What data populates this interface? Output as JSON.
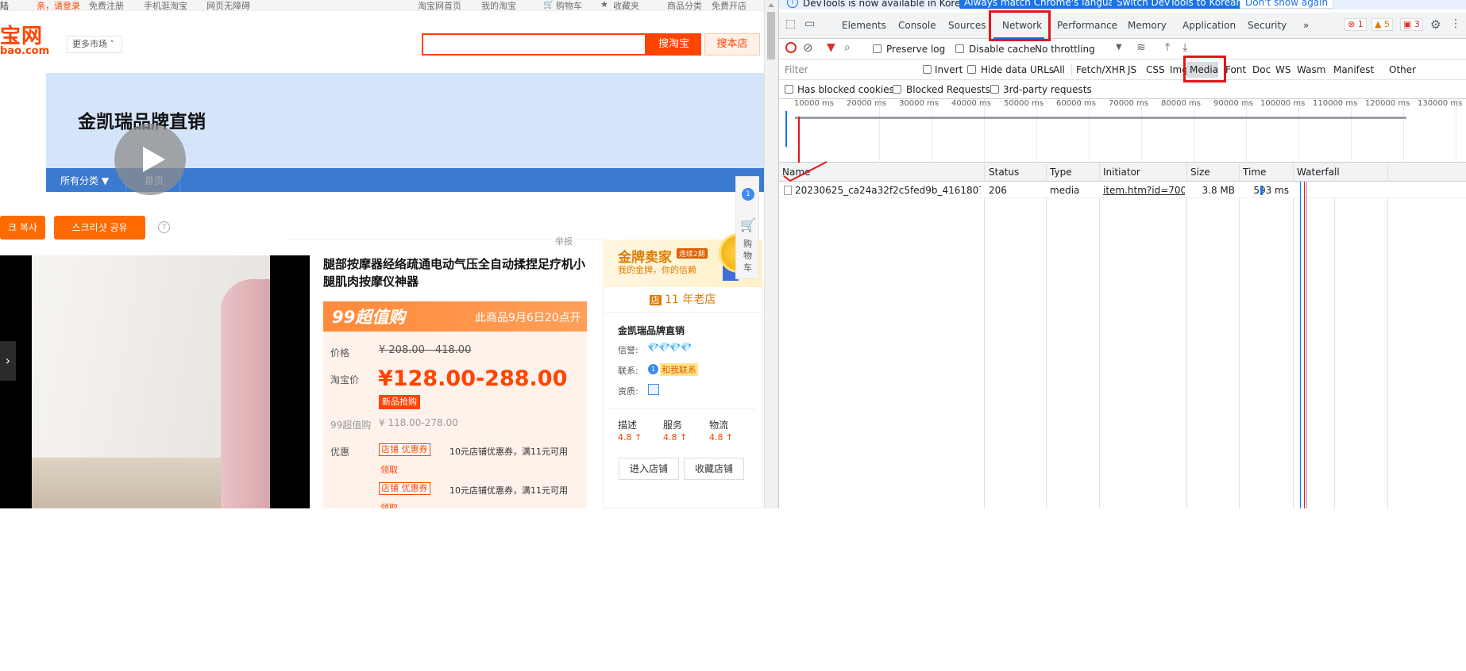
{
  "taobao": {
    "topbar": {
      "login_prefix": "陆",
      "login": "亲，请登录",
      "register": "免费注册",
      "mobile": "手机逛淘宝",
      "accessible": "网页无障碍",
      "home": "淘宝网首页",
      "my_taobao": "我的淘宝",
      "cart": "购物车",
      "favorites": "收藏夹",
      "categories": "商品分类",
      "free_shop": "免费开店"
    },
    "logo_big": "宝网",
    "logo_small": "bao.com",
    "more_market": "更多市场",
    "search_button": "搜淘宝",
    "search_shop": "搜本店",
    "shop_name": "金凯瑞品牌直销",
    "nav": {
      "all": "所有分类 ▼",
      "home": "首页"
    },
    "korean_btn1": "크 복사",
    "korean_btn2": "스크리샷 공유",
    "help": "?",
    "report": "举报",
    "product_title": "腿部按摩器经络疏通电动气压全自动揉捏足疗机小腿肌肉按摩仪神器",
    "promo_logo": "99超值购",
    "promo_text": "此商品9月6日20点开",
    "price_label": "价格",
    "original_price": "¥ 208.00 - 418.00",
    "tb_price_label": "淘宝价",
    "tb_price": "¥128.00-288.00",
    "new_tag": "新品抢购",
    "p99_label": "99超值购",
    "p99_price": "¥ 118.00-278.00",
    "coupon_label": "优惠",
    "coupons": [
      {
        "tag": "店铺 优惠券",
        "desc": "10元店铺优惠券，满11元可用",
        "action": "领取"
      },
      {
        "tag": "店铺 优惠券",
        "desc": "10元店铺优惠券，满11元可用",
        "action": "领取"
      }
    ],
    "gold": {
      "title": "金牌卖家",
      "badge": "连续2期",
      "sub": "我的金牌，你的信赖"
    },
    "old_shop": "11 年老店",
    "card_shop_name": "金凯瑞品牌直销",
    "credit_label": "信誉:",
    "credit_diamonds": "💎💎💎💎",
    "contact_label": "联系:",
    "contact_link": "和我联系",
    "qualification_label": "资质:",
    "ratings": [
      {
        "label": "描述",
        "value": "4.8 ↑"
      },
      {
        "label": "服务",
        "value": "4.8 ↑"
      },
      {
        "label": "物流",
        "value": "4.8 ↑"
      }
    ],
    "enter_shop": "进入店铺",
    "fav_shop": "收藏店铺",
    "side_badge": "1",
    "side_cart": "购物车"
  },
  "devtools": {
    "infobar": {
      "text": "DevTools is now available in Korean!",
      "btn_match": "Always match Chrome's language",
      "btn_switch": "Switch DevTools to Korean",
      "btn_dismiss": "Don't show again"
    },
    "tabs": [
      "Elements",
      "Console",
      "Sources",
      "Network",
      "Performance",
      "Memory",
      "Application",
      "Security"
    ],
    "more_tabs": "»",
    "errors": "1",
    "warnings": "5",
    "issues": "3",
    "toolbar": {
      "preserve_log": "Preserve log",
      "disable_cache": "Disable cache",
      "throttling": "No throttling"
    },
    "filter": {
      "placeholder": "Filter",
      "invert": "Invert",
      "hide_data_urls": "Hide data URLs",
      "types": [
        "All",
        "Fetch/XHR",
        "JS",
        "CSS",
        "Img",
        "Media",
        "Font",
        "Doc",
        "WS",
        "Wasm",
        "Manifest",
        "Other"
      ]
    },
    "filter2": {
      "blocked_cookies": "Has blocked cookies",
      "blocked_requests": "Blocked Requests",
      "third_party": "3rd-party requests"
    },
    "overview_ticks": [
      "10000 ms",
      "20000 ms",
      "30000 ms",
      "40000 ms",
      "50000 ms",
      "60000 ms",
      "70000 ms",
      "80000 ms",
      "90000 ms",
      "100000 ms",
      "110000 ms",
      "120000 ms",
      "130000 ms"
    ],
    "columns": [
      "Name",
      "Status",
      "Type",
      "Initiator",
      "Size",
      "Time",
      "Waterfall"
    ],
    "rows": [
      {
        "name": "20230625_ca24a32f2c5fed9b_4161807440...",
        "status": "206",
        "type": "media",
        "initiator": "item.htm?id=700483...",
        "size": "3.8 MB",
        "time": "593 ms"
      }
    ]
  },
  "colors": {
    "taobao_orange": "#ff4400",
    "devtools_blue": "#1a73e8",
    "highlight_red": "#e0161c"
  }
}
